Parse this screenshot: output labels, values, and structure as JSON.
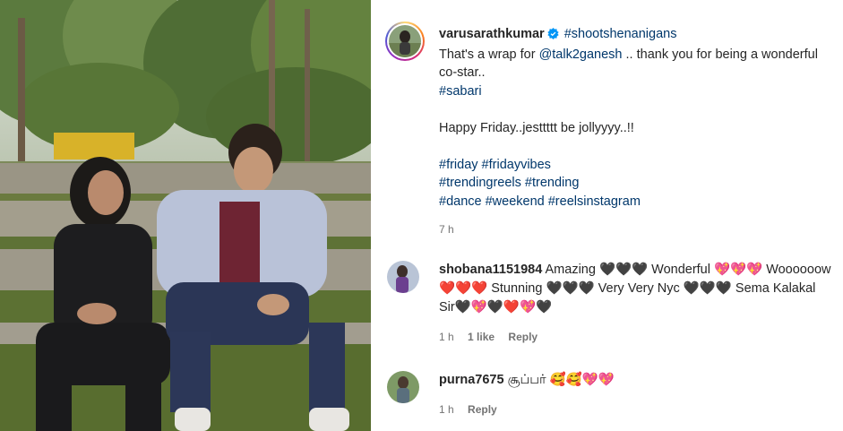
{
  "post": {
    "username": "varusarathkumar",
    "tag": "#shootshenanigans",
    "line1_pre": "That's a wrap for ",
    "mention": "@talk2ganesh",
    "line1_post": " .. thank you for being a wonderful co-star..",
    "sabari": "#sabari",
    "friday_line": "Happy Friday..jesttttt be jollyyyy..!!",
    "hashtag_lines": [
      "#friday #fridayvibes",
      "#trendingreels #trending",
      "#dance #weekend #reelsinstagram"
    ],
    "time": "7 h"
  },
  "comments": [
    {
      "username": "shobana1151984",
      "text": "Amazing 🖤🖤🖤 Wonderful 💖💖💖 Woooooow ❤️❤️❤️ Stunning 🖤🖤🖤 Very Very Nyc 🖤🖤🖤 Sema Kalakal Sir🖤💖🖤❤️💖🖤",
      "time": "1 h",
      "likes": "1 like",
      "reply": "Reply"
    },
    {
      "username": "purna7675",
      "text": "சூப்பர் 🥰🥰💖💖",
      "time": "1 h",
      "reply": "Reply"
    }
  ],
  "icons": {
    "verified": "verified-badge-icon",
    "avatar": "profile-avatar"
  },
  "colors": {
    "link": "#00376b",
    "verified": "#0095f6",
    "meta": "#737373"
  }
}
